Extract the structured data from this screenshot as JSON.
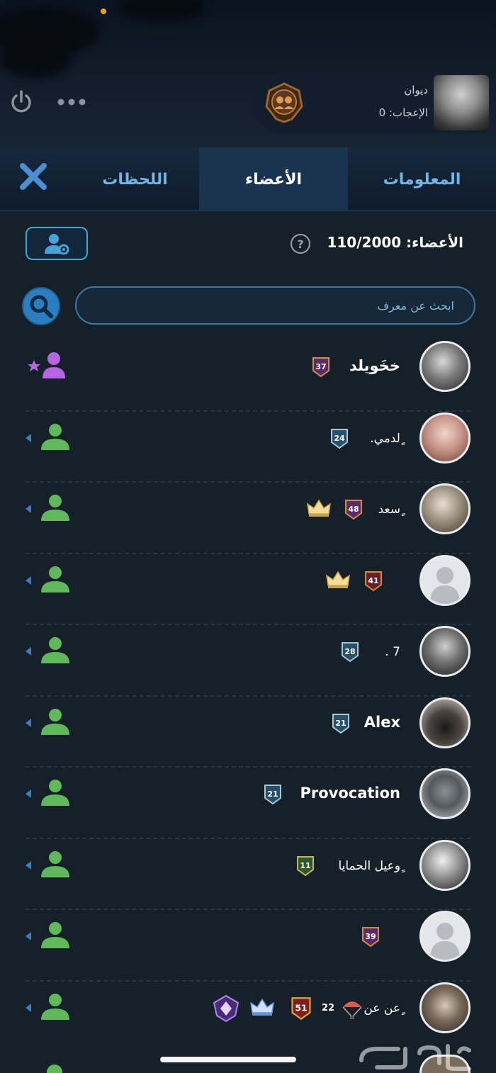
{
  "group": {
    "name": "ديوان",
    "likes": "الإعجاب: 0"
  },
  "tabs": {
    "info": "المعلومات",
    "members": "الأعضاء",
    "moments": "اللحظات"
  },
  "members_header": {
    "count": "الأعضاء: 110/2000",
    "help": "?"
  },
  "search": {
    "placeholder": "ابحث عن معرف"
  },
  "members": [
    {
      "name": "خخَويلد",
      "level": "37"
    },
    {
      "name": "ٍلدمي.",
      "level": "24"
    },
    {
      "name": "ٍسعد",
      "level": "48"
    },
    {
      "name": "",
      "level": "41"
    },
    {
      "name": "7 .",
      "level": "28"
    },
    {
      "name": "Alex",
      "level": "21"
    },
    {
      "name": "Provocation",
      "level": "21"
    },
    {
      "name": "ٍوعيل الحمايا",
      "level": "11"
    },
    {
      "name": "",
      "level": "39"
    },
    {
      "name": "ٍعن عن",
      "level": "51",
      "extra": "22"
    }
  ],
  "colors": {
    "accent": "#6fb6e6",
    "member_icon": "#5fb85a",
    "admin_icon": "#b565e6",
    "background": "#152029"
  }
}
